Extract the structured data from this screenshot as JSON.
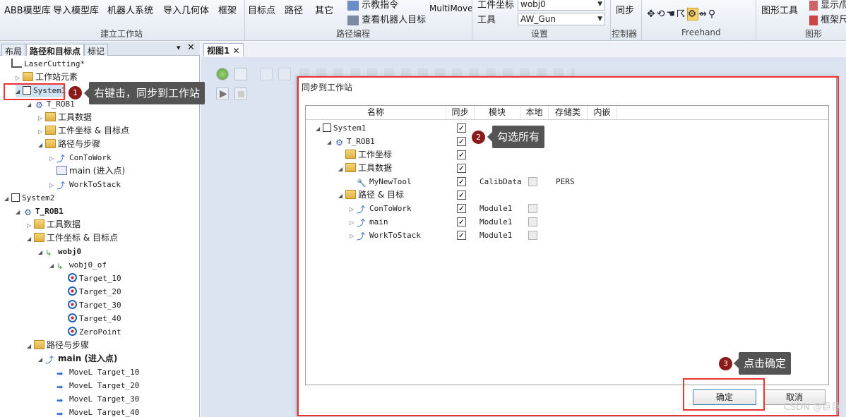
{
  "ribbon": {
    "items": [
      "ABB模型库",
      "导入模型库",
      "机器人系统",
      "导入几何体",
      "框架",
      "目标点",
      "路径",
      "其它",
      "示教指令",
      "查看机器人目标",
      "MultiMove",
      "工件坐标",
      "工具",
      "同步",
      "图形工具",
      "显示/隐藏",
      "框架尺寸"
    ],
    "workobj_value": "wobj0",
    "tool_value": "AW_Gun",
    "groups": [
      "建立工作站",
      "路径编程",
      "设置",
      "控制器",
      "Freehand",
      "图形"
    ]
  },
  "left_panel": {
    "tabs": [
      "布局",
      "路径和目标点",
      "标记"
    ],
    "tree": [
      {
        "label": "LaserCutting*",
        "level": 0,
        "icon": "station-icon"
      },
      {
        "label": "工作站元素",
        "level": 1,
        "icon": "folder-icon",
        "toggle": "▷"
      },
      {
        "label": "System1",
        "level": 1,
        "icon": "system-icon",
        "toggle": "◢"
      },
      {
        "label": "T_ROB1",
        "level": 2,
        "icon": "robot-task-icon",
        "toggle": "◢"
      },
      {
        "label": "工具数据",
        "level": 3,
        "icon": "tooldata-icon",
        "toggle": "▷"
      },
      {
        "label": "工件坐标 & 目标点",
        "level": 3,
        "icon": "workobj-icon",
        "toggle": "▷"
      },
      {
        "label": "路径与步骤",
        "level": 3,
        "icon": "folder-icon",
        "toggle": "◢"
      },
      {
        "label": "ConToWork",
        "level": 4,
        "icon": "path-icon",
        "toggle": "▷"
      },
      {
        "label": "main (进入点)",
        "level": 4,
        "icon": "main-proc-icon"
      },
      {
        "label": "WorkToStack",
        "level": 4,
        "icon": "path-icon",
        "toggle": "▷"
      },
      {
        "label": "System2",
        "level": 0,
        "icon": "system-icon",
        "toggle": "◢"
      },
      {
        "label": "T_ROB1",
        "level": 1,
        "icon": "robot-task-icon",
        "toggle": "◢",
        "bold": true
      },
      {
        "label": "工具数据",
        "level": 2,
        "icon": "tooldata-icon",
        "toggle": "▷"
      },
      {
        "label": "工件坐标 & 目标点",
        "level": 2,
        "icon": "workobj-icon",
        "toggle": "◢"
      },
      {
        "label": "wobj0",
        "level": 3,
        "icon": "wobj-icon",
        "toggle": "◢",
        "bold": true
      },
      {
        "label": "wobj0_of",
        "level": 4,
        "icon": "wobj-icon",
        "toggle": "◢"
      },
      {
        "label": "Target_10",
        "level": 5,
        "icon": "target-icon"
      },
      {
        "label": "Target_20",
        "level": 5,
        "icon": "target-icon"
      },
      {
        "label": "Target_30",
        "level": 5,
        "icon": "target-icon"
      },
      {
        "label": "Target_40",
        "level": 5,
        "icon": "target-icon"
      },
      {
        "label": "ZeroPoint",
        "level": 5,
        "icon": "target-icon"
      },
      {
        "label": "路径与步骤",
        "level": 2,
        "icon": "folder-icon",
        "toggle": "◢"
      },
      {
        "label": "main (进入点)",
        "level": 3,
        "icon": "path-icon",
        "toggle": "◢",
        "bold": true
      },
      {
        "label": "MoveL Target_10",
        "level": 4,
        "icon": "move-icon"
      },
      {
        "label": "MoveL Target_20",
        "level": 4,
        "icon": "move-icon"
      },
      {
        "label": "MoveL Target_30",
        "level": 4,
        "icon": "move-icon"
      },
      {
        "label": "MoveL Target_40",
        "level": 4,
        "icon": "move-icon"
      }
    ]
  },
  "view": {
    "tab_label": "视图1"
  },
  "dialog": {
    "title": "同步到工作站",
    "columns": [
      "名称",
      "同步",
      "模块",
      "本地",
      "存储类",
      "内嵌"
    ],
    "rows": [
      {
        "name": "System1",
        "level": 0,
        "icon": "system-icon",
        "toggle": "◢",
        "sync": true,
        "module": "",
        "local": null,
        "storage": ""
      },
      {
        "name": "T_ROB1",
        "level": 1,
        "icon": "robot-task-icon",
        "toggle": "◢",
        "sync": true,
        "module": "",
        "local": null,
        "storage": ""
      },
      {
        "name": "工作坐标",
        "level": 2,
        "icon": "workobj-icon",
        "sync": true,
        "module": "",
        "local": null,
        "storage": ""
      },
      {
        "name": "工具数据",
        "level": 2,
        "icon": "tooldata-icon",
        "toggle": "◢",
        "sync": true,
        "module": "",
        "local": null,
        "storage": ""
      },
      {
        "name": "MyNewTool",
        "level": 3,
        "icon": "tool-icon",
        "sync": true,
        "module": "CalibData",
        "local": false,
        "storage": "PERS"
      },
      {
        "name": "路径 & 目标",
        "level": 2,
        "icon": "folder-icon",
        "toggle": "◢",
        "sync": true,
        "module": "",
        "local": null,
        "storage": ""
      },
      {
        "name": "ConToWork",
        "level": 3,
        "icon": "path-icon",
        "toggle": "▷",
        "sync": true,
        "module": "Module1",
        "local": false,
        "storage": ""
      },
      {
        "name": "main",
        "level": 3,
        "icon": "path-icon",
        "toggle": "▷",
        "sync": true,
        "module": "Module1",
        "local": false,
        "storage": ""
      },
      {
        "name": "WorkToStack",
        "level": 3,
        "icon": "path-icon",
        "toggle": "▷",
        "sync": true,
        "module": "Module1",
        "local": false,
        "storage": ""
      }
    ],
    "ok_label": "确定",
    "cancel_label": "取消"
  },
  "annotations": [
    {
      "num": "1",
      "text": "右键击，同步到工作站"
    },
    {
      "num": "2",
      "text": "勾选所有"
    },
    {
      "num": "3",
      "text": "点击确定"
    }
  ],
  "watermark": "CSDN @巨巨",
  "colors": {
    "highlight_red": "#e33333",
    "badge": "#8b1a1a",
    "callout_bg": "#545454"
  }
}
